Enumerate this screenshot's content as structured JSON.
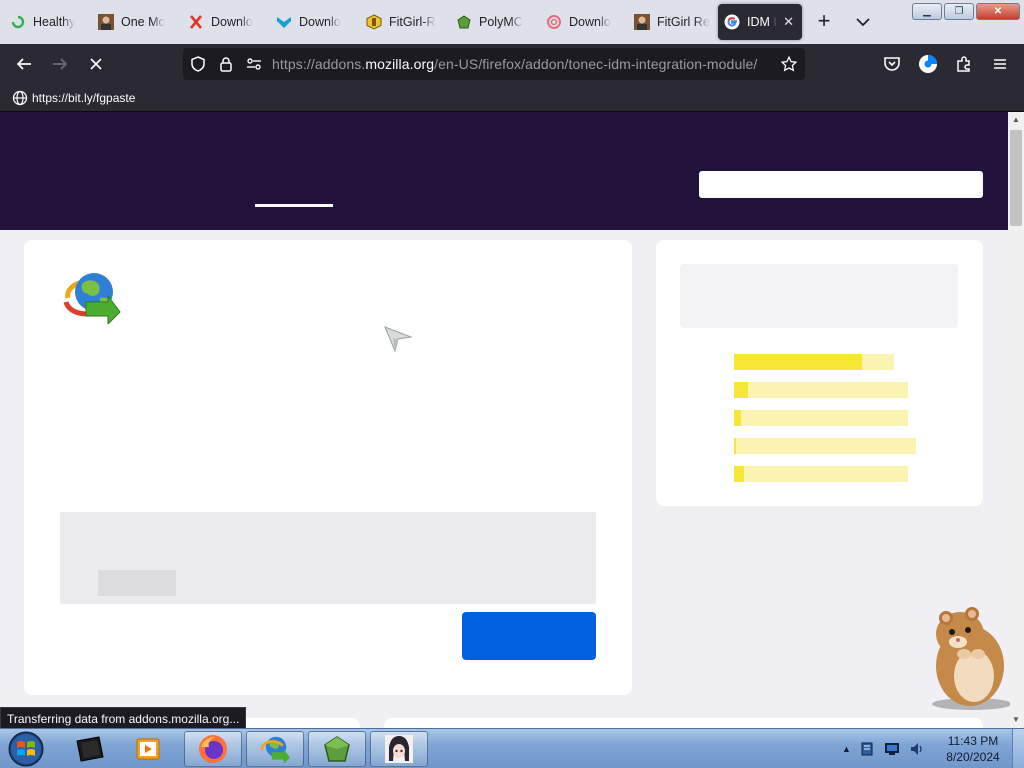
{
  "tabs": [
    {
      "title": "Healthy",
      "icon": "green-ring-icon"
    },
    {
      "title": "One Mo",
      "icon": "avatar-icon"
    },
    {
      "title": "Downlo",
      "icon": "red-x-icon"
    },
    {
      "title": "Downlo",
      "icon": "blue-arrow-icon"
    },
    {
      "title": "FitGirl-R",
      "icon": "coin-icon"
    },
    {
      "title": "PolyMC",
      "icon": "green-cube-icon"
    },
    {
      "title": "Downlo",
      "icon": "pink-swirl-icon"
    },
    {
      "title": "FitGirl Re",
      "icon": "avatar-icon"
    },
    {
      "title": "IDM I",
      "icon": "google-icon",
      "active": true
    }
  ],
  "navbar": {
    "url_prefix": "https://addons.",
    "url_domain": "mozilla.org",
    "url_path": "/en-US/firefox/addon/tonec-idm-integration-module/"
  },
  "bookmarks": [
    {
      "label": "https://bit.ly/fgpaste",
      "icon": "globe-icon"
    }
  ],
  "ratings_bars": [
    {
      "fill": 0.8
    },
    {
      "fill": 0.08
    },
    {
      "fill": 0.04
    },
    {
      "fill": 0.01
    },
    {
      "fill": 0.06
    }
  ],
  "status": {
    "text": "Transferring data from addons.mozilla.org..."
  },
  "taskbar": {
    "items": [
      "terminal-app",
      "media-player-app",
      "firefox-app",
      "idm-app",
      "polymc-app",
      "anime-avatar-app"
    ],
    "clock_time": "11:43 PM",
    "clock_date": "8/20/2024"
  },
  "colors": {
    "hero": "#20123a",
    "primary": "#0060df",
    "rating_fill": "#f5e733",
    "rating_track": "#fbf3b0",
    "active_tab": "#2b2a33"
  }
}
